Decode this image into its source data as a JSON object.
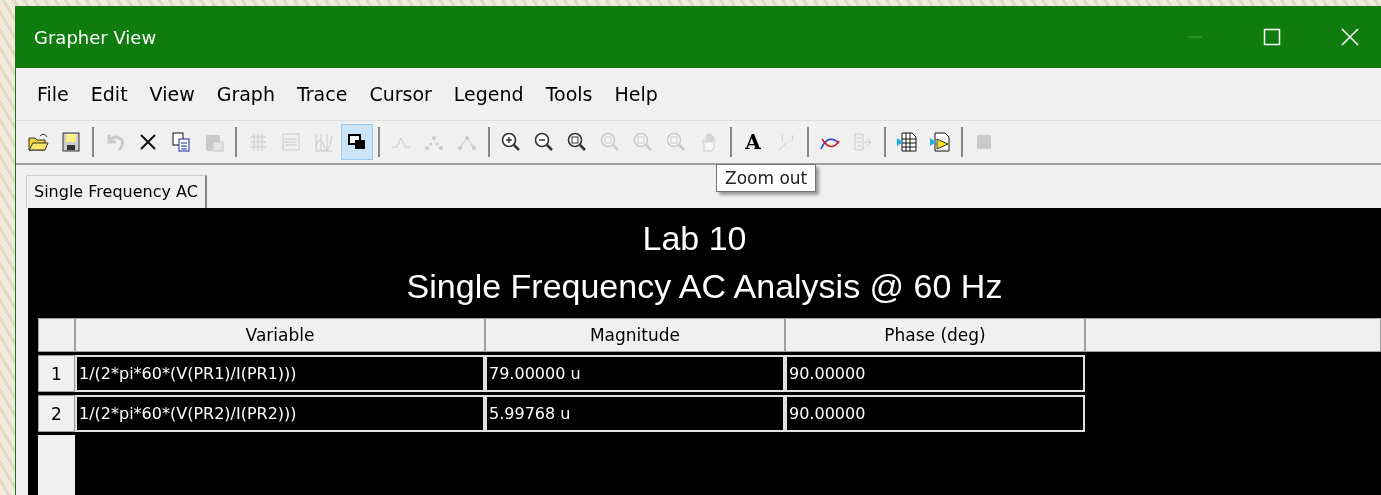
{
  "window": {
    "title": "Grapher View",
    "minimize_disabled": true
  },
  "menu": [
    "File",
    "Edit",
    "View",
    "Graph",
    "Trace",
    "Cursor",
    "Legend",
    "Tools",
    "Help"
  ],
  "toolbar": [
    {
      "buttons": [
        {
          "disabled": false,
          "selected": false
        },
        {
          "disabled": false,
          "selected": false
        }
      ]
    },
    {
      "buttons": [
        {
          "disabled": true,
          "selected": false
        },
        {
          "disabled": false,
          "selected": false
        },
        {
          "disabled": false,
          "selected": false
        },
        {
          "disabled": true,
          "selected": false
        }
      ]
    },
    {
      "buttons": [
        {
          "disabled": true,
          "selected": false
        },
        {
          "disabled": true,
          "selected": false
        },
        {
          "disabled": true,
          "selected": false
        },
        {
          "disabled": false,
          "selected": true
        }
      ]
    },
    {
      "buttons": [
        {
          "disabled": true,
          "selected": false
        },
        {
          "disabled": true,
          "selected": false
        },
        {
          "disabled": true,
          "selected": false
        }
      ]
    },
    {
      "buttons": [
        {
          "disabled": false,
          "selected": false
        },
        {
          "disabled": false,
          "selected": false
        },
        {
          "disabled": false,
          "selected": false
        },
        {
          "disabled": true,
          "selected": false
        },
        {
          "disabled": true,
          "selected": false
        },
        {
          "disabled": true,
          "selected": false
        },
        {
          "disabled": true,
          "selected": false
        }
      ]
    },
    {
      "buttons": [
        {
          "disabled": false,
          "selected": false,
          "label": "A"
        },
        {
          "disabled": true,
          "selected": false
        }
      ]
    },
    {
      "buttons": [
        {
          "disabled": false,
          "selected": false
        },
        {
          "disabled": true,
          "selected": false
        }
      ]
    },
    {
      "buttons": [
        {
          "disabled": false,
          "selected": false
        },
        {
          "disabled": false,
          "selected": false
        }
      ]
    },
    {
      "buttons": [
        {
          "disabled": true,
          "selected": false
        }
      ]
    }
  ],
  "tooltip": "Zoom out",
  "tabs": [
    {
      "label": "Single Frequency AC",
      "selected": true
    }
  ],
  "graph": {
    "title": "Lab 10",
    "subtitle": "Single Frequency AC Analysis @ 60 Hz"
  },
  "table": {
    "columns": [
      "Variable",
      "Magnitude",
      "Phase (deg)"
    ],
    "rows": [
      {
        "number": "1",
        "cells": [
          "1/(2*pi*60*(V(PR1)/I(PR1)))",
          "79.00000 u",
          "90.00000"
        ]
      },
      {
        "number": "2",
        "cells": [
          "1/(2*pi*60*(V(PR2)/I(PR2)))",
          "5.99768 u",
          "90.00000"
        ]
      }
    ]
  }
}
